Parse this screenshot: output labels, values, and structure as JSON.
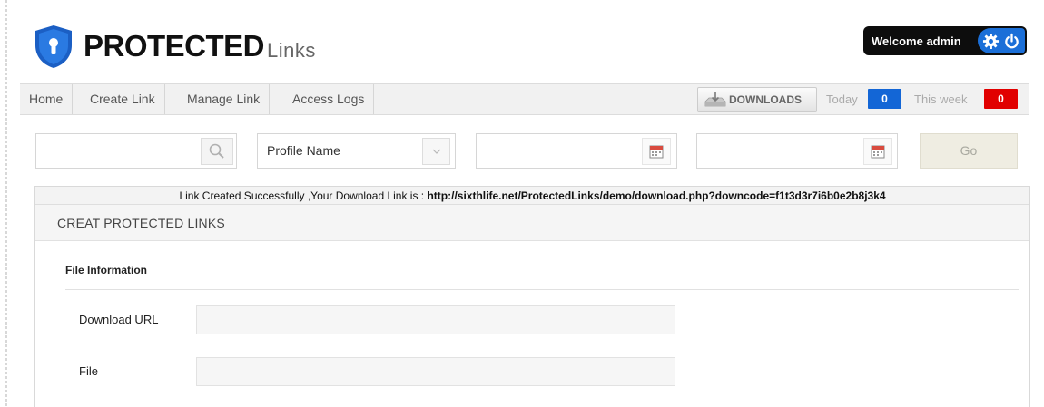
{
  "header": {
    "brand_strong": "PROTECTED",
    "brand_light": "Links",
    "logo_icon": "shield-keyhole-icon",
    "welcome_text": "Welcome admin",
    "settings_icon": "gear-icon",
    "power_icon": "power-icon"
  },
  "nav": {
    "items": [
      "Home",
      "Create Link",
      "Manage Link",
      "Access Logs"
    ],
    "downloads_label": "DOWNLOADS",
    "downloads_icon": "downloads-icon",
    "today_label": "Today",
    "today_count": "0",
    "week_label": "This week",
    "week_count": "0"
  },
  "filter": {
    "search_value": "",
    "search_icon": "search-icon",
    "profile_select": "Profile Name",
    "dropdown_icon": "chevron-down-icon",
    "date_from_value": "",
    "date_to_value": "",
    "calendar_icon": "calendar-icon",
    "go_label": "Go"
  },
  "panel": {
    "success_prefix": "Link Created Successfully ,Your Download Link is : ",
    "success_link": "http://sixthlife.net/ProtectedLinks/demo/download.php?downcode=f1t3d3r7i6b0e2b8j3k4",
    "heading": "CREAT PROTECTED LINKS",
    "section_title": "File Information",
    "fields": [
      {
        "label": "Download URL",
        "value": ""
      },
      {
        "label": "File",
        "value": ""
      }
    ]
  },
  "colors": {
    "brand_blue": "#1b6fd8",
    "today_badge": "#1366d6",
    "week_badge": "#e10000"
  }
}
